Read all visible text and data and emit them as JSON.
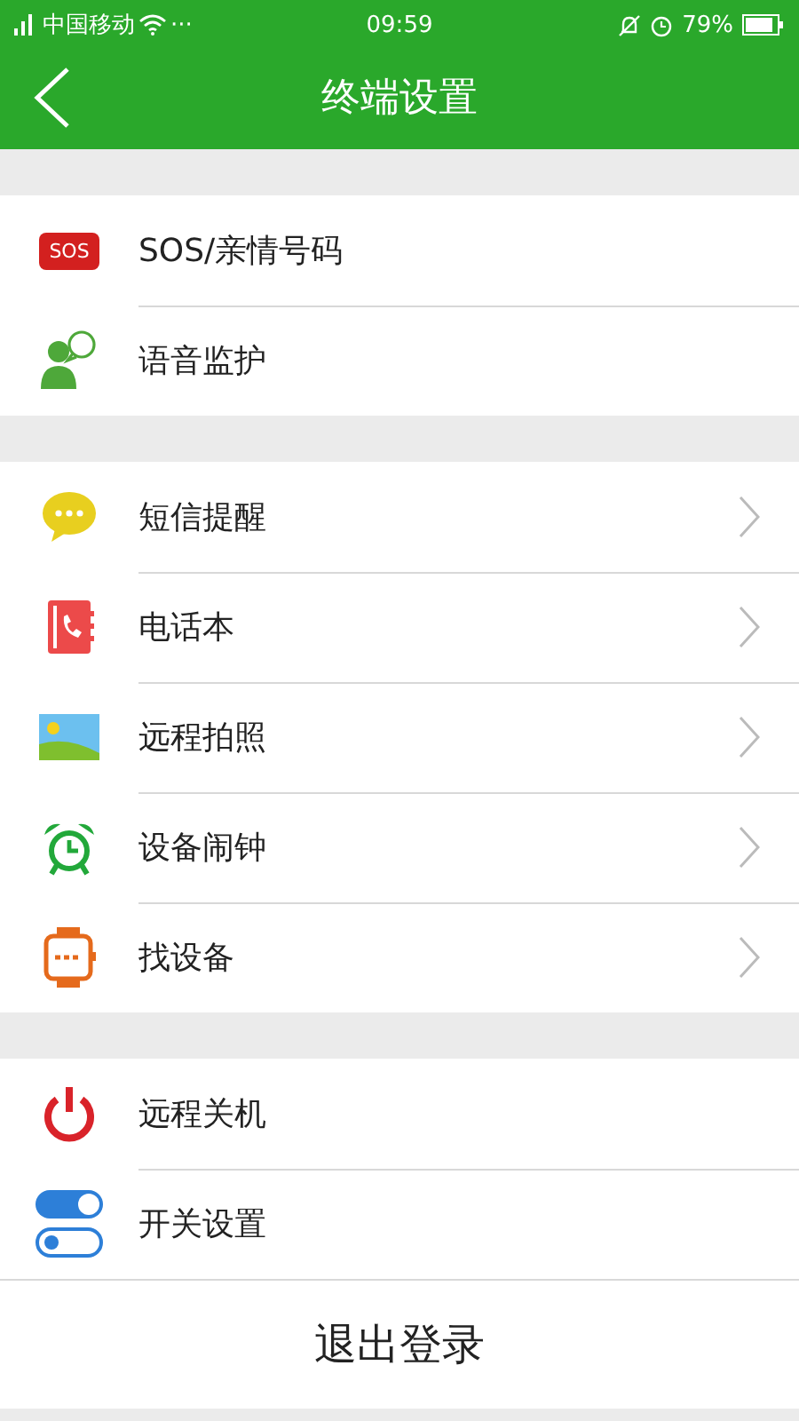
{
  "status_bar": {
    "carrier": "中国移动",
    "more": "···",
    "time": "09:59",
    "battery": "79%"
  },
  "header": {
    "title": "终端设置"
  },
  "groups": [
    {
      "items": [
        {
          "kind": "sos",
          "badge": "SOS",
          "label": "SOS/亲情号码",
          "chevron": false
        },
        {
          "kind": "voice",
          "label": "语音监护",
          "chevron": false
        }
      ]
    },
    {
      "items": [
        {
          "kind": "message",
          "label": "短信提醒",
          "chevron": true
        },
        {
          "kind": "phonebook",
          "label": "电话本",
          "chevron": true
        },
        {
          "kind": "photo",
          "label": "远程拍照",
          "chevron": true
        },
        {
          "kind": "alarm",
          "label": "设备闹钟",
          "chevron": true
        },
        {
          "kind": "watch",
          "label": "找设备",
          "chevron": true
        }
      ]
    },
    {
      "items": [
        {
          "kind": "power",
          "label": "远程关机",
          "chevron": false
        },
        {
          "kind": "switches",
          "label": "开关设置",
          "chevron": false
        }
      ]
    }
  ],
  "logout": "退出登录"
}
